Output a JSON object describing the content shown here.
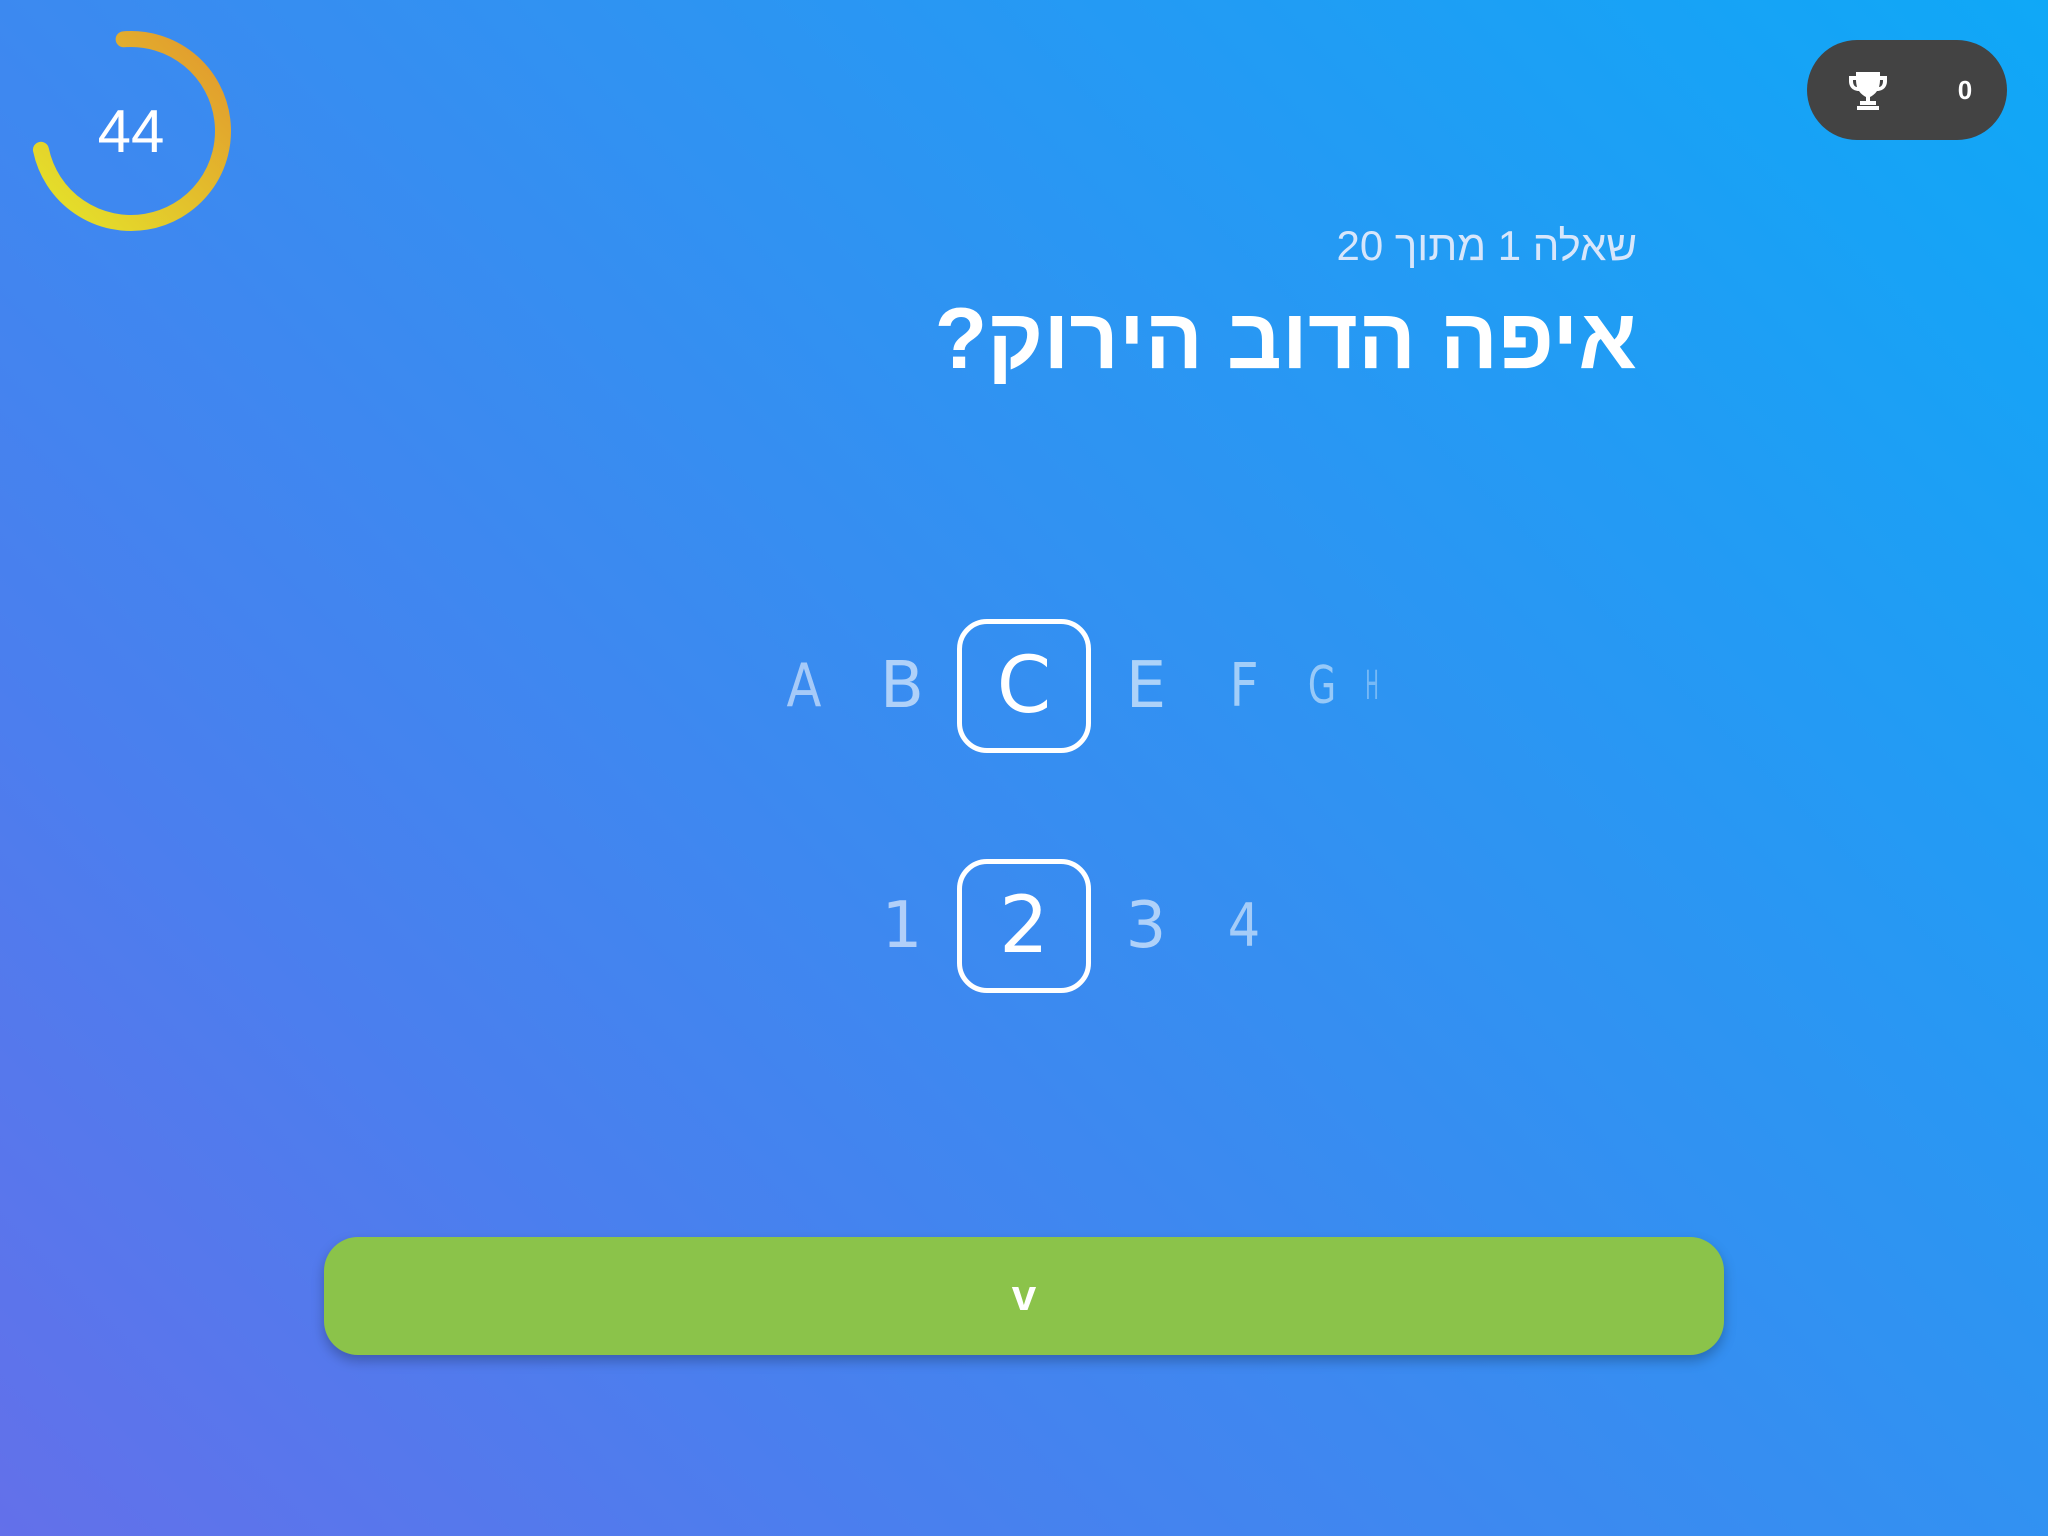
{
  "timer": {
    "value": "44",
    "fraction_remaining": 0.73
  },
  "score": {
    "icon": "trophy-icon",
    "value": "0"
  },
  "question": {
    "progress": "שאלה 1 מתוך 20",
    "text": "איפה הדוב הירוק?"
  },
  "letter_picker": {
    "items": [
      "A",
      "B",
      "C",
      "E",
      "F",
      "G",
      "H"
    ],
    "selected": "C"
  },
  "number_picker": {
    "items": [
      "1",
      "2",
      "3",
      "4"
    ],
    "selected": "2"
  },
  "submit": {
    "label": "v",
    "color": "#8bc34a"
  },
  "colors": {
    "accent": "#8bc34a",
    "pill": "#434343",
    "timer_start": "#e3e62b",
    "timer_end": "#e3952c"
  }
}
